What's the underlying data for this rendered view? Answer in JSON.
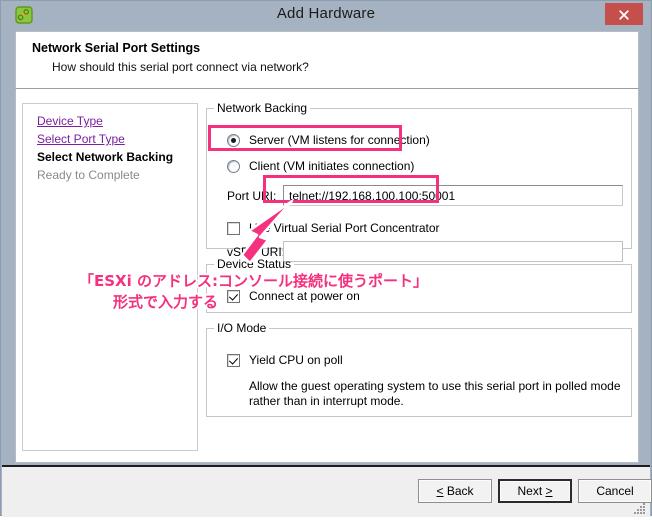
{
  "window": {
    "title": "Add Hardware",
    "icon": "vmware-app-icon",
    "close_label": "Close"
  },
  "header": {
    "title": "Network Serial Port Settings",
    "subtitle": "How should this serial port connect via network?"
  },
  "sidebar": {
    "items": [
      {
        "label": "Device Type",
        "state": "done"
      },
      {
        "label": "Select Port Type",
        "state": "done"
      },
      {
        "label": "Select Network Backing",
        "state": "current"
      },
      {
        "label": "Ready to Complete",
        "state": "future"
      }
    ]
  },
  "network_backing": {
    "legend": "Network Backing",
    "server_radio": {
      "label": "Server (VM listens for connection)",
      "checked": true
    },
    "client_radio": {
      "label": "Client  (VM initiates connection)",
      "checked": false
    },
    "port_uri": {
      "label": "Port URI:",
      "value": "telnet://192.168.100.100:50001",
      "placeholder": ""
    },
    "vspc_checkbox": {
      "label": "Use Virtual Serial Port Concentrator",
      "checked": false
    },
    "vspc_uri": {
      "label": "vSPC URI:",
      "value": "",
      "placeholder": "",
      "disabled": true
    }
  },
  "device_status": {
    "legend": "Device Status",
    "connect_at_power_on": {
      "label": "Connect at power on",
      "checked": true
    }
  },
  "io_mode": {
    "legend": "I/O Mode",
    "yield_cpu": {
      "label": "Yield CPU on poll",
      "checked": true
    },
    "description_line1": "Allow the guest operating system to use this serial port in polled mode",
    "description_line2": "rather than in interrupt mode."
  },
  "footer": {
    "back_label": "< Back",
    "next_label": "Next >",
    "cancel_label": "Cancel"
  },
  "annotations": {
    "accent_color": "#f5317f",
    "line1": "「ESXi のアドレス:コンソール接続に使うポート」",
    "line2": "形式で入力する"
  }
}
